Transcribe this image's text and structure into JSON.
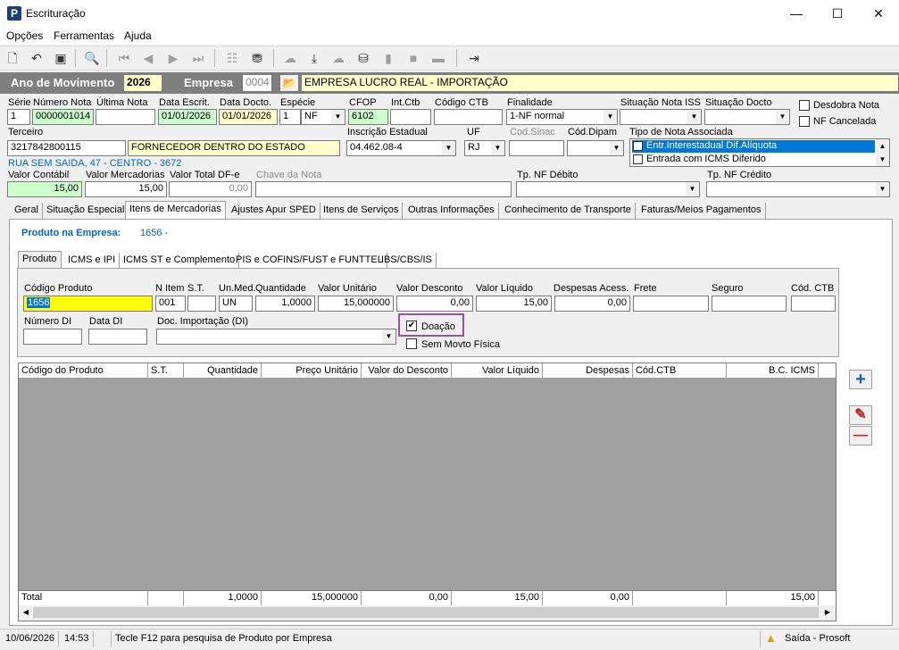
{
  "window": {
    "title": "Escrituração",
    "minimize": "—",
    "maximize": "☐",
    "close": "✕"
  },
  "menu": [
    "Opções",
    "Ferramentas",
    "Ajuda"
  ],
  "toolbar": {
    "icons": [
      "new-doc-icon",
      "undo-icon",
      "save-icon",
      "preview-icon",
      "first-icon",
      "prev-icon",
      "next-icon",
      "last-icon",
      "tree-icon",
      "stamp-icon",
      "cloud-icon",
      "download-icon",
      "cloud2-icon",
      "coins-icon",
      "doc-icon",
      "doc2-icon",
      "minus-icon",
      "exit-icon"
    ]
  },
  "header": {
    "ano_label": "Ano de Movimento",
    "ano_value": "2026",
    "empresa_label": "Empresa",
    "empresa_code": "0004",
    "empresa_name": "EMPRESA LUCRO REAL - IMPORTAÇÃO"
  },
  "form": {
    "serie_label": "Série",
    "serie": "1",
    "numero_label": "Número Nota",
    "numero": "0000001014",
    "ultima_label": "Última Nota",
    "ultima": "",
    "data_escrit_label": "Data Escrit.",
    "data_escrit": "01/01/2026",
    "data_docto_label": "Data Docto.",
    "data_docto": "01/01/2026",
    "especie_label": "Espécie",
    "especie_num": "1",
    "especie": "NF",
    "cfop_label": "CFOP",
    "cfop": "6102",
    "intctb_label": "Int.Ctb",
    "intctb": "",
    "codctb_label": "Código CTB",
    "codctb": "",
    "finalidade_label": "Finalidade",
    "finalidade": "1-NF normal",
    "sit_iss_label": "Situação Nota ISS",
    "sit_iss": "",
    "sit_docto_label": "Situação Docto",
    "sit_docto": "",
    "desdobra_label": "Desdobra Nota",
    "cancelada_label": "NF Cancelada",
    "terceiro_label": "Terceiro",
    "terceiro_code": "3217842800115",
    "terceiro_name": "FORNECEDOR DENTRO DO ESTADO",
    "ie_label": "Inscrição Estadual",
    "ie": "04.462.08-4",
    "uf_label": "UF",
    "uf": "RJ",
    "codsinac_label": "Cod.Sinac",
    "codsinac": "",
    "coddipam_label": "Cód.Dipam",
    "coddipam": "",
    "tipo_assoc_label": "Tipo de Nota Associada",
    "tipo_assoc": [
      "Entr.Interestadual Dif.Alíquota",
      "Entrada com ICMS Diferido"
    ],
    "endereco": "RUA SEM SAIDA, 47 - CENTRO - 3672",
    "valor_contabil_label": "Valor Contábil",
    "valor_contabil": "15,00",
    "valor_merc_label": "Valor Mercadorias",
    "valor_merc": "15,00",
    "valor_dfe_label": "Valor Total DF-e",
    "valor_dfe": "0,00",
    "chave_label": "Chave da Nota",
    "chave": "",
    "tp_debito_label": "Tp. NF Débito",
    "tp_debito": "",
    "tp_credito_label": "Tp. NF Crédito",
    "tp_credito": ""
  },
  "tabs": [
    "Geral",
    "Situação Especial",
    "Itens de Mercadorias",
    "Ajustes Apur SPED",
    "Itens de Serviços",
    "Outras Informações",
    "Conhecimento de Transporte",
    "Faturas/Meios Pagamentos"
  ],
  "produto_empresa": {
    "label": "Produto na Empresa:",
    "value": "1656 -"
  },
  "subtabs": [
    "Produto",
    "ICMS e IPI",
    "ICMS ST e Complemento",
    "PIS e COFINS/FUST e FUNTTEL",
    "IBS/CBS/IS"
  ],
  "item": {
    "cod_prod_label": "Código Produto",
    "cod_prod": "1656",
    "nitem_label": "N Item",
    "nitem": "001",
    "st_label": "S.T.",
    "st": "",
    "unmed_label": "Un.Med.",
    "unmed": "UN",
    "qtd_label": "Quantidade",
    "qtd": "1,0000",
    "vunit_label": "Valor Unitário",
    "vunit": "15,000000",
    "vdesc_label": "Valor Desconto",
    "vdesc": "0,00",
    "vliq_label": "Valor Líquido",
    "vliq": "15,00",
    "desp_label": "Despesas Acess.",
    "desp": "0,00",
    "frete_label": "Frete",
    "frete": "",
    "seguro_label": "Seguro",
    "seguro": "",
    "codctb_label": "Cód. CTB",
    "codctb": "",
    "numdi_label": "Número DI",
    "numdi": "",
    "datadi_label": "Data DI",
    "datadi": "",
    "docimp_label": "Doc. Importação (DI)",
    "docimp": "",
    "doacao_label": "Doação",
    "doacao_checked": "✔",
    "semmovto_label": "Sem Movto Física"
  },
  "grid": {
    "headers": [
      "Código do Produto",
      "S.T.",
      "Quantidade",
      "Preço Unitário",
      "Valor do Desconto",
      "Valor Líquido",
      "Despesas",
      "Cód.CTB",
      "B.C. ICMS"
    ],
    "total": [
      "Total",
      "",
      "1,0000",
      "15,000000",
      "0,00",
      "15,00",
      "0,00",
      "",
      "15,00"
    ]
  },
  "side_buttons": {
    "add": "+",
    "edit": "✎",
    "remove": "—"
  },
  "status": {
    "date": "10/06/2026",
    "time": "14:53",
    "hint": "Tecle F12 para pesquisa de Produto por Empresa",
    "mode": "Saída - Prosoft"
  },
  "colors": {
    "accent": "#0066cc",
    "header_bar": "#7f7f7f",
    "highlight_yellow": "#ffff00",
    "focus_purple": "#9b4fa6"
  }
}
